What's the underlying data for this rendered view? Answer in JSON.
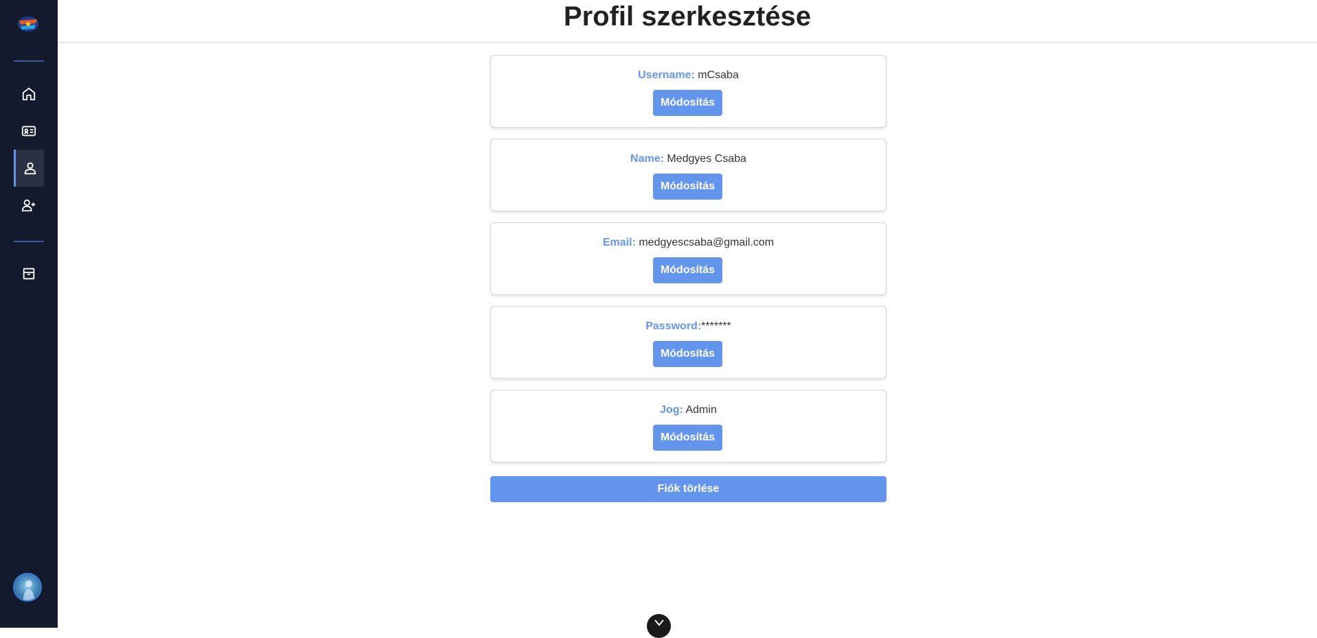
{
  "app": {
    "logo_text": "SPORTS",
    "title": "Profil szerkesztése"
  },
  "sidebar": {
    "items": [
      {
        "icon": "home-icon"
      },
      {
        "icon": "id-card-icon"
      },
      {
        "icon": "user-icon",
        "active": true
      },
      {
        "icon": "user-plus-icon"
      },
      {
        "icon": "archive-icon"
      }
    ],
    "avatar": "avatar"
  },
  "profile": {
    "fields": [
      {
        "label": "Username:",
        "value": " mCsaba",
        "button": "Módosítás"
      },
      {
        "label": "Name:",
        "value": " Medgyes Csaba",
        "button": "Módosítás"
      },
      {
        "label": "Email:",
        "value": " medgyescsaba@gmail.com",
        "button": "Módosítás"
      },
      {
        "label": "Password:",
        "value": "*******",
        "button": "Módosítás"
      },
      {
        "label": "Jog:",
        "value": " Admin",
        "button": "Módosítás"
      }
    ],
    "delete_label": "Fiók törlése"
  },
  "colors": {
    "sidebar_bg": "#141a2e",
    "accent": "#6495ed"
  }
}
